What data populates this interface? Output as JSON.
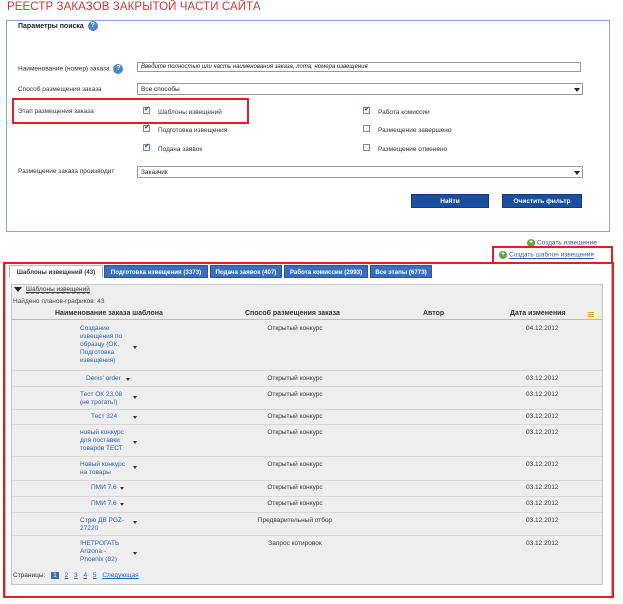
{
  "page": {
    "title": "РЕЕСТР ЗАКАЗОВ ЗАКРЫТОЙ ЧАСТИ САЙТА"
  },
  "search": {
    "section_title": "Параметры поиска",
    "order_name_label": "Наименование (номер) заказа",
    "order_name_placeholder": "Введите полностью или часть наименования заказа, лота, номера извещения",
    "method_label": "Способ размещения заказа",
    "method_value": "Все способы",
    "stage_label": "Этап размещения заказа",
    "stages": [
      {
        "label": "Шаблоны извещений",
        "checked": true
      },
      {
        "label": "Подготовка извещения",
        "checked": true
      },
      {
        "label": "Подача заявок",
        "checked": true
      },
      {
        "label": "Работа комиссии",
        "checked": true
      },
      {
        "label": "Размещение завершено",
        "checked": false
      },
      {
        "label": "Размещение отменено",
        "checked": false
      }
    ],
    "producer_label": "Размещение заказа производит",
    "producer_value": "Заказчик",
    "find_label": "Найти",
    "clear_label": "Очистить фильтр",
    "help_icon": "question-icon"
  },
  "links": {
    "create_notice": "Создать извещение",
    "create_template": "Создать шаблон извещения",
    "icon": "plus-icon"
  },
  "tabs": [
    {
      "label": "Шаблоны извещений (43)",
      "active": true
    },
    {
      "label": "Подготовка извещения (3373)",
      "active": false
    },
    {
      "label": "Подача заявок (407)",
      "active": false
    },
    {
      "label": "Работа комиссии (2993)",
      "active": false
    },
    {
      "label": "Все этапы (6773)",
      "active": false
    }
  ],
  "grid": {
    "group_label": "Шаблоны извещений",
    "found_text": "Найдено планов-графиков: 43",
    "columns": [
      "Наименование заказа шаблона",
      "Способ размещения заказа",
      "Автор",
      "Дата изменения"
    ],
    "rows": [
      {
        "name": "Создание извещения по образцу (ОК, Подготовка извещения)",
        "method": "Открытый конкурс",
        "author": "",
        "date": "04.12.2012"
      },
      {
        "name": "Denis' order",
        "method": "Открытый конкурс",
        "author": "",
        "date": "03.12.2012"
      },
      {
        "name": "Тест ОК 23.08 (не трогать!)",
        "method": "Открытый конкурс",
        "author": "",
        "date": "03.12.2012"
      },
      {
        "name": "Тест 324",
        "method": "Открытый конкурс",
        "author": "",
        "date": "03.12.2012"
      },
      {
        "name": "новый конкурс для поставки товаров ТЕСТ",
        "method": "Открытый конкурс",
        "author": "",
        "date": "03.12.2012"
      },
      {
        "name": "Новый конкурс на товары",
        "method": "Открытый конкурс",
        "author": "",
        "date": "03.12.2012"
      },
      {
        "name": "ПМИ 7.6",
        "method": "Открытый конкурс",
        "author": "",
        "date": "03.12.2012"
      },
      {
        "name": "ПМИ 7.6",
        "method": "Открытый конкурс",
        "author": "",
        "date": "03.12.2012"
      },
      {
        "name": "Стрю ДВ PGZ-27220",
        "method": "Предварительный отбор",
        "author": "",
        "date": "03.12.2012"
      },
      {
        "name": "!НЕТРОГАТЬ Arizona - Phoenix (82)",
        "method": "Запрос котировок",
        "author": "",
        "date": "03.12.2012"
      }
    ]
  },
  "pager": {
    "label": "Страницы:",
    "pages": [
      "1",
      "2",
      "3",
      "4",
      "5"
    ],
    "current": "1",
    "next": "Следующая"
  },
  "colors": {
    "accent": "#3a6fb8",
    "title": "#c8393a",
    "highlight": "#dd2222",
    "button": "#1a4fa0"
  }
}
